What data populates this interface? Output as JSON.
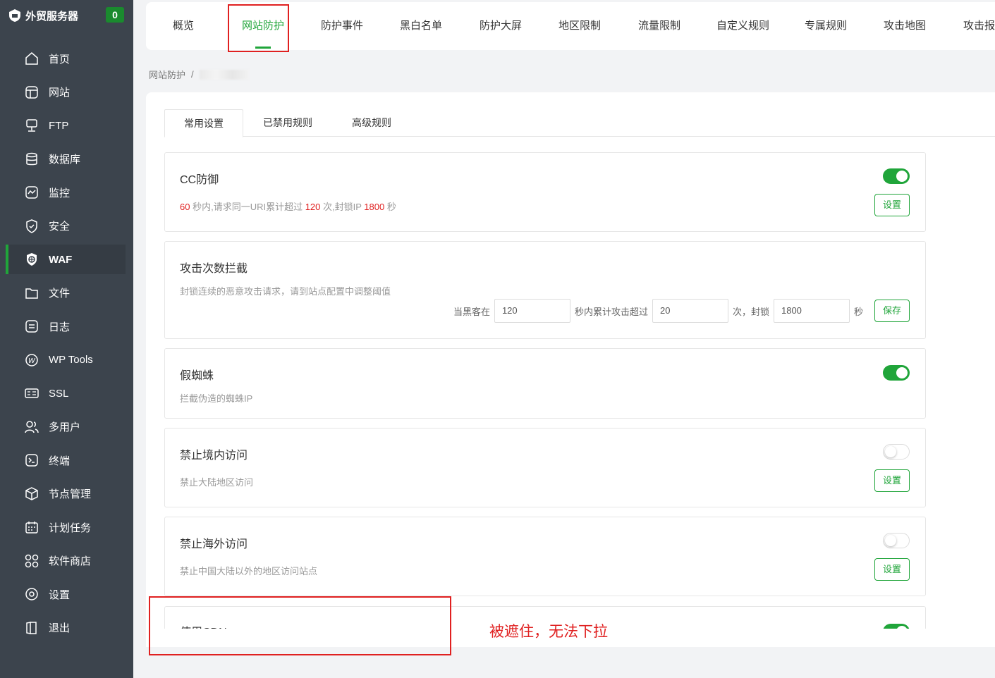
{
  "sidebar": {
    "brand": "外贸服务器",
    "badge": "0",
    "items": [
      {
        "label": "首页",
        "icon": "home-icon"
      },
      {
        "label": "网站",
        "icon": "globe-icon"
      },
      {
        "label": "FTP",
        "icon": "ftp-icon"
      },
      {
        "label": "数据库",
        "icon": "database-icon"
      },
      {
        "label": "监控",
        "icon": "monitor-icon"
      },
      {
        "label": "安全",
        "icon": "shield-icon"
      },
      {
        "label": "WAF",
        "icon": "waf-icon"
      },
      {
        "label": "文件",
        "icon": "folder-icon"
      },
      {
        "label": "日志",
        "icon": "log-icon"
      },
      {
        "label": "WP Tools",
        "icon": "wordpress-icon"
      },
      {
        "label": "SSL",
        "icon": "ssl-icon"
      },
      {
        "label": "多用户",
        "icon": "users-icon"
      },
      {
        "label": "终端",
        "icon": "terminal-icon"
      },
      {
        "label": "节点管理",
        "icon": "cube-icon"
      },
      {
        "label": "计划任务",
        "icon": "calendar-icon"
      },
      {
        "label": "软件商店",
        "icon": "apps-icon"
      },
      {
        "label": "设置",
        "icon": "settings-icon"
      },
      {
        "label": "退出",
        "icon": "logout-icon"
      }
    ],
    "active_index": 6
  },
  "topnav": {
    "tabs": [
      "概览",
      "网站防护",
      "防护事件",
      "黑白名单",
      "防护大屏",
      "地区限制",
      "流量限制",
      "自定义规则",
      "专属规则",
      "攻击地图",
      "攻击报"
    ],
    "active_index": 1
  },
  "breadcrumb": {
    "root": "网站防护",
    "separator": "/"
  },
  "subtabs": [
    "常用设置",
    "已禁用规则",
    "高级规则"
  ],
  "cards": {
    "cc": {
      "title": "CC防御",
      "enabled": true,
      "desc_parts": [
        "60",
        " 秒内,请求同一URI累计超过 ",
        "120",
        " 次,封锁IP ",
        "1800",
        " 秒"
      ],
      "button": "设置"
    },
    "attack": {
      "title": "攻击次数拦截",
      "desc": "封锁连续的恶意攻击请求，请到站点配置中调整阈值",
      "label1": "当黑客在",
      "value1": "120",
      "label2": "秒内累计攻击超过",
      "value2": "20",
      "label3": "次，封锁",
      "value3": "1800",
      "label4": "秒",
      "button": "保存"
    },
    "spider": {
      "title": "假蜘蛛",
      "enabled": true,
      "desc": "拦截伪造的蜘蛛IP"
    },
    "domestic": {
      "title": "禁止境内访问",
      "enabled": false,
      "desc": "禁止大陆地区访问",
      "button": "设置"
    },
    "overseas": {
      "title": "禁止海外访问",
      "enabled": false,
      "desc": "禁止中国大陆以外的地区访问站点",
      "button": "设置"
    },
    "cdn": {
      "title": "使用CDN",
      "enabled": true
    }
  },
  "annotation": "被遮住，无法下拉",
  "colors": {
    "accent": "#20a53a",
    "sidebar_bg": "#3c444d",
    "annotation_red": "#e02020"
  }
}
